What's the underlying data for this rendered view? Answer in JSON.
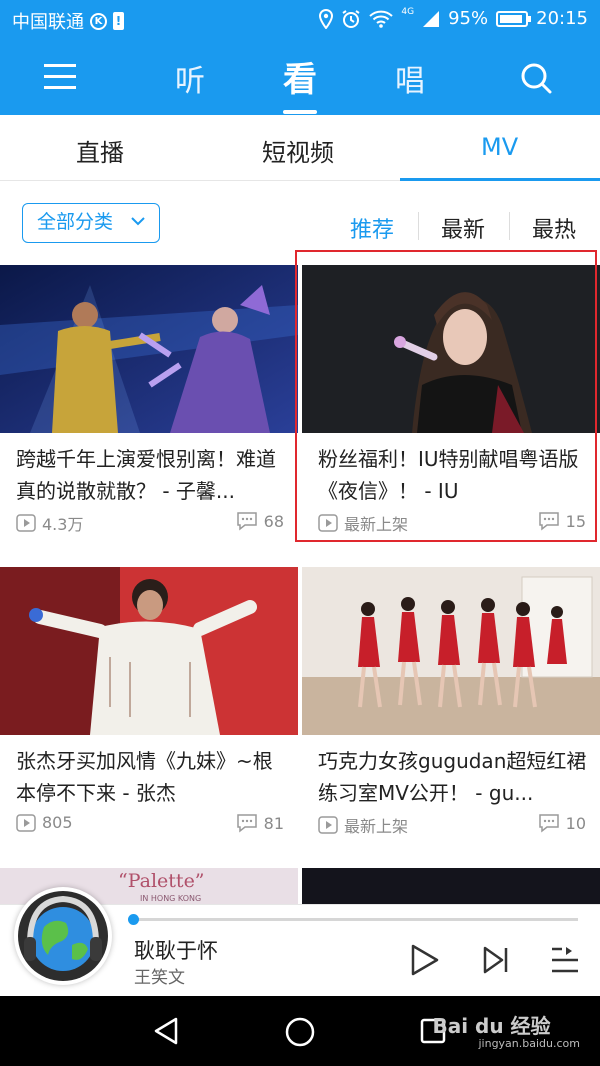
{
  "status_bar": {
    "carrier": "中国联通",
    "carrier_badge": "K",
    "network": "4G",
    "battery": "95%",
    "time": "20:15"
  },
  "top_nav": {
    "tabs": [
      {
        "label": "听"
      },
      {
        "label": "看"
      },
      {
        "label": "唱"
      }
    ],
    "active_tab": "看"
  },
  "sub_tabs": {
    "items": [
      {
        "label": "直播"
      },
      {
        "label": "短视频"
      },
      {
        "label": "MV"
      }
    ],
    "active": "MV"
  },
  "filter": {
    "category_label": "全部分类",
    "sort_options": [
      {
        "label": "推荐"
      },
      {
        "label": "最新"
      },
      {
        "label": "最热"
      }
    ],
    "active_sort": "推荐"
  },
  "cards": [
    {
      "title": "跨越千年上演爱恨别离！难道真的说散就散？ - 子馨...",
      "plays": "4.3万",
      "comments": "68"
    },
    {
      "title": "粉丝福利！IU特别献唱粤语版《夜信》！ - IU",
      "plays": "最新上架",
      "comments": "15"
    },
    {
      "title": "张杰牙买加风情《九妹》~根本停不下来 - 张杰",
      "plays": "805",
      "comments": "81"
    },
    {
      "title": "巧克力女孩gugudan超短红裙练习室MV公开！ - gu...",
      "plays": "最新上架",
      "comments": "10"
    }
  ],
  "partial_card": {
    "thumb_text": "“Palette”",
    "thumb_subtext": "IN HONG KONG"
  },
  "player": {
    "song_title": "耿耿于怀",
    "artist": "王笑文",
    "progress": 0.01
  },
  "colors": {
    "brand_blue": "#1a9aef",
    "highlight_red": "#e0282e"
  },
  "watermark": {
    "brand": "Bai du 经验",
    "url": "jingyan.baidu.com"
  }
}
